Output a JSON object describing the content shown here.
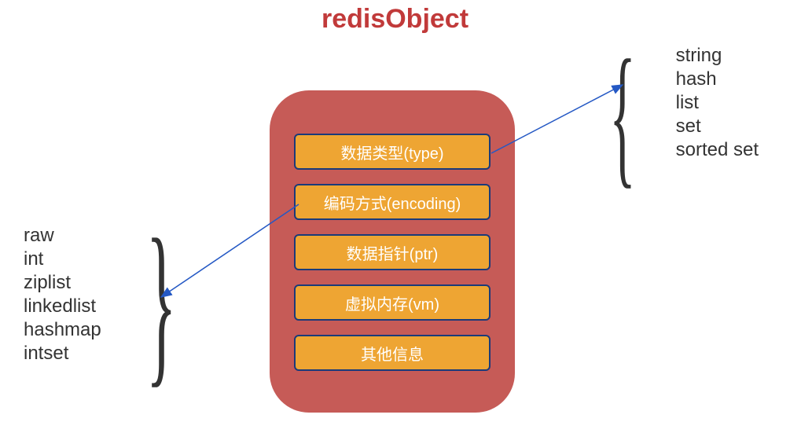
{
  "title": "redisObject",
  "fields": [
    {
      "label": "数据类型(type)"
    },
    {
      "label": "编码方式(encoding)"
    },
    {
      "label": "数据指针(ptr)"
    },
    {
      "label": "虚拟内存(vm)"
    },
    {
      "label": "其他信息"
    }
  ],
  "type_values": [
    "string",
    "hash",
    "list",
    "set",
    "sorted set"
  ],
  "encoding_values": [
    "raw",
    "int",
    "ziplist",
    "linkedlist",
    "hashmap",
    "intset"
  ],
  "arrows": {
    "type_to_right": {
      "from": "encoding-field-area",
      "to": "right-brace"
    },
    "encoding_to_left": {
      "from": "encoding-field-area",
      "to": "left-brace"
    }
  },
  "colors": {
    "title": "#c13a3a",
    "container": "#c65b57",
    "field_bg": "#eea533",
    "field_border": "#1a3a7a",
    "arrow": "#2458c4"
  }
}
